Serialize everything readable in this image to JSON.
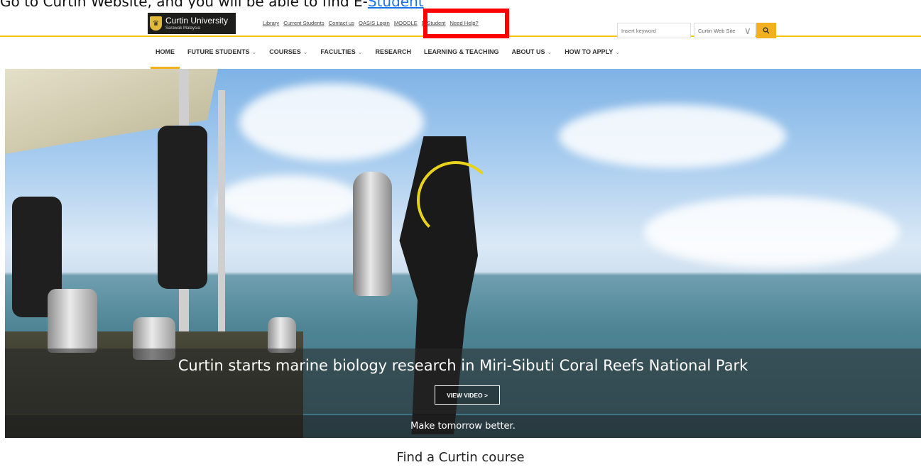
{
  "caption": {
    "text": "Go to Curtin Website,  and you will be able to find E-",
    "link_text": "Student"
  },
  "brand": {
    "title": "Curtin University",
    "subtitle": "Sarawak Malaysia",
    "accent_color": "#f2b01e"
  },
  "utility_links": [
    "Library",
    "Current Students",
    "Contact us",
    "OASIS Login",
    "MOODLE",
    "E-Student",
    "Need Help?"
  ],
  "search": {
    "placeholder": "Insert keyword",
    "scope_selected": "Curtin Web Site",
    "button_icon": "search-icon"
  },
  "nav": [
    {
      "label": "HOME",
      "active": true,
      "dropdown": false
    },
    {
      "label": "FUTURE STUDENTS",
      "dropdown": true
    },
    {
      "label": "COURSES",
      "dropdown": true
    },
    {
      "label": "FACULTIES",
      "dropdown": true
    },
    {
      "label": "RESEARCH",
      "dropdown": false
    },
    {
      "label": "LEARNING & TEACHING",
      "dropdown": false
    },
    {
      "label": "ABOUT US",
      "dropdown": true
    },
    {
      "label": "HOW TO APPLY",
      "dropdown": true
    }
  ],
  "hero": {
    "headline": "Curtin starts marine biology research in Miri-Sibuti Coral Reefs National Park",
    "button_label": "VIEW VIDEO >",
    "tagline": "Make tomorrow better."
  },
  "section": {
    "find_course_title": "Find a Curtin course"
  },
  "annotation": {
    "highlight_color": "#ff0000",
    "highlight_target": "E-Student"
  }
}
